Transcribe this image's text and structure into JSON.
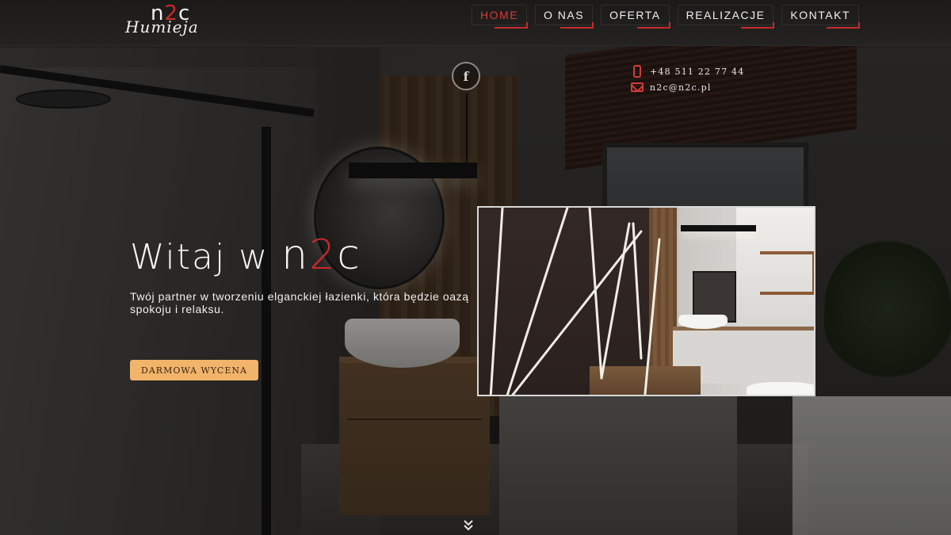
{
  "brand": {
    "name_prefix": "n",
    "name_accent": "2",
    "name_suffix": "c",
    "script_name": "Humieja",
    "accent_color": "#c82a2a"
  },
  "nav": {
    "items": [
      {
        "label": "HOME",
        "active": true
      },
      {
        "label": "O NAS",
        "active": false
      },
      {
        "label": "OFERTA",
        "active": false
      },
      {
        "label": "REALIZACJE",
        "active": false
      },
      {
        "label": "KONTAKT",
        "active": false
      }
    ]
  },
  "social": {
    "facebook_glyph": "f",
    "facebook_icon": "facebook-icon"
  },
  "contact": {
    "phone": "+48 511 22 77 44",
    "email": "n2c@n2c.pl",
    "phone_icon": "phone-icon",
    "email_icon": "mail-icon"
  },
  "hero": {
    "title_prefix": "Witaj w ",
    "brand_prefix": "n",
    "brand_accent": "2",
    "brand_suffix": "c",
    "subtitle": "Twój partner w tworzeniu elganckiej łazienki, która będzie oazą spokoju i relaksu.",
    "cta_label": "DARMOWA WYCENA",
    "cta_color": "#f2b46a"
  },
  "scroll": {
    "icon": "double-chevron-down-icon"
  }
}
